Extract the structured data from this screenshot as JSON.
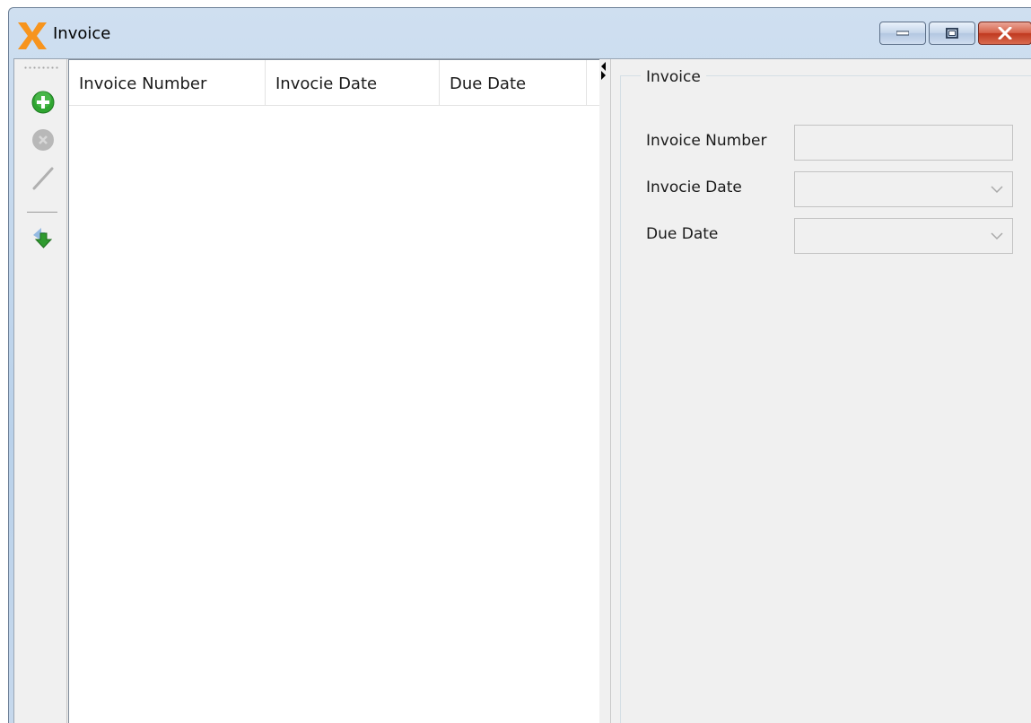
{
  "window": {
    "title": "Invoice"
  },
  "toolbar": {
    "buttons": [
      {
        "icon": "add-icon",
        "enabled": true
      },
      {
        "icon": "delete-icon",
        "enabled": false
      },
      {
        "icon": "edit-icon",
        "enabled": false
      },
      {
        "icon": "import-icon",
        "enabled": true
      }
    ]
  },
  "grid": {
    "columns": [
      "Invoice Number",
      "Invocie Date",
      "Due Date"
    ],
    "rows": []
  },
  "detail": {
    "group_title": "Invoice",
    "fields": [
      {
        "label": "Invoice Number",
        "value": "",
        "type": "text"
      },
      {
        "label": "Invocie Date",
        "value": "",
        "type": "dropdown"
      },
      {
        "label": "Due Date",
        "value": "",
        "type": "dropdown"
      }
    ]
  },
  "colors": {
    "accent_orange": "#f7941d",
    "add_green": "#2fa531",
    "close_red": "#c0391f"
  }
}
